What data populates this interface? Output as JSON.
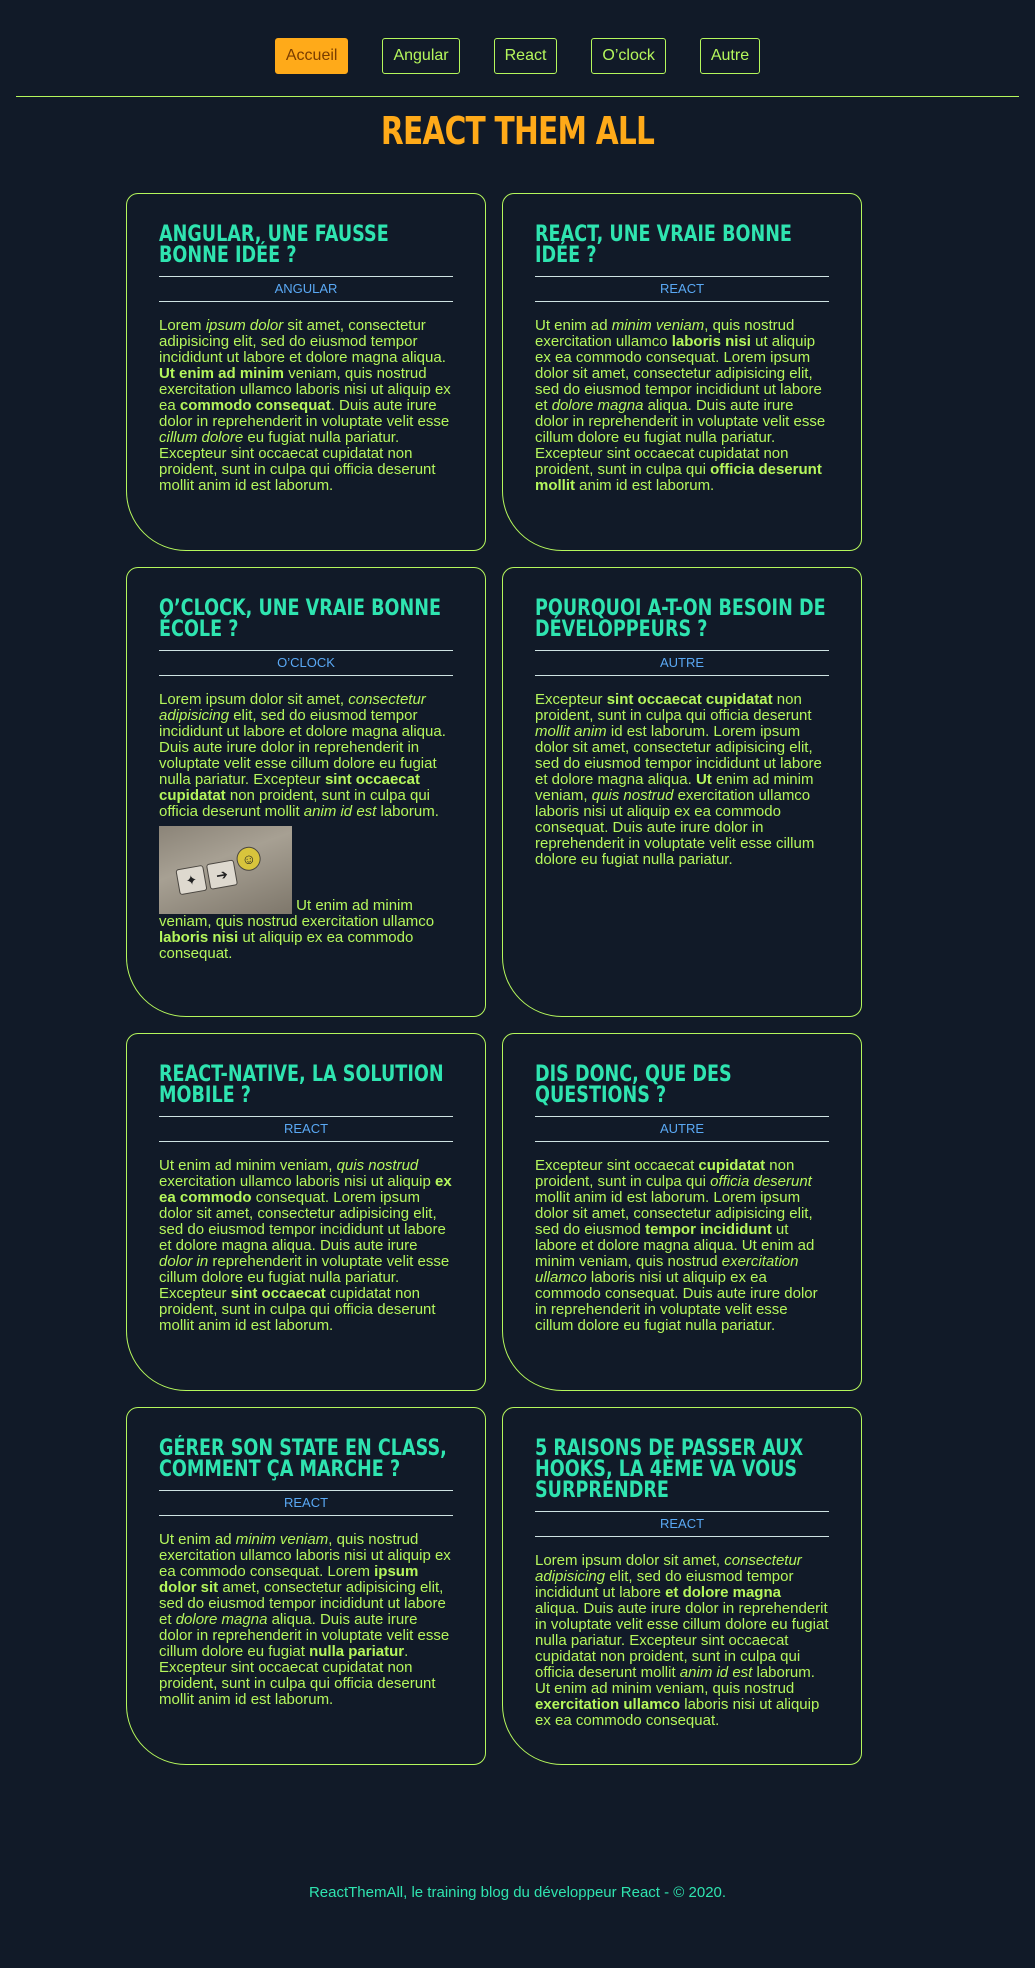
{
  "nav": {
    "items": [
      {
        "label": "Accueil",
        "active": true
      },
      {
        "label": "Angular",
        "active": false
      },
      {
        "label": "React",
        "active": false
      },
      {
        "label": "O’clock",
        "active": false
      },
      {
        "label": "Autre",
        "active": false
      }
    ]
  },
  "site_title": "REACT THEM ALL",
  "colors": {
    "background": "#111a28",
    "accent_orange": "#ffaa19",
    "text_green": "#b5f75c",
    "title_teal": "#2fe4b0",
    "category_blue": "#5aa9f5"
  },
  "cards": [
    {
      "title": "Angular, une fausse bonne idée ?",
      "category": "Angular",
      "body_html": "Lorem <i>ipsum dolor</i> sit amet, consectetur adipisicing elit, sed do eiusmod tempor incididunt ut labore et dolore magna aliqua. <b>Ut enim ad minim</b> veniam, quis nostrud exercitation ullamco laboris nisi ut aliquip ex ea <b>commodo consequat</b>. Duis aute irure dolor in reprehenderit in voluptate velit esse <i>cillum dolore</i> eu fugiat nulla pariatur. Excepteur sint occaecat cupidatat non proident, sunt in culpa qui officia deserunt mollit anim id est laborum."
    },
    {
      "title": "React, une vraie bonne idée ?",
      "category": "React",
      "body_html": "Ut enim ad <i>minim veniam</i>, quis nostrud exercitation ullamco <b>laboris nisi</b> ut aliquip ex ea commodo consequat. Lorem ipsum dolor sit amet, consectetur adipisicing elit, sed do eiusmod tempor incididunt ut labore et <i>dolore magna</i> aliqua. Duis aute irure dolor in reprehenderit in voluptate velit esse cillum dolore eu fugiat nulla pariatur. Excepteur sint occaecat cupidatat non proident, sunt in culpa qui <b>officia deserunt mollit</b> anim id est laborum."
    },
    {
      "title": "O’clock, une vraie bonne école ?",
      "category": "O’clock",
      "body_html": "Lorem ipsum dolor sit amet, <i>consectetur adipisicing</i> elit, sed do eiusmod tempor incididunt ut labore et dolore magna aliqua. Duis aute irure dolor in reprehenderit in voluptate velit esse cillum dolore eu fugiat nulla pariatur. Excepteur <b>sint occaecat cupidatat</b> non proident, sunt in culpa qui officia deserunt mollit <i>anim id est</i> laborum.",
      "image_alt": "keyboard keys with arrow and smiley",
      "after_image_html": " Ut enim ad minim veniam, quis nostrud exercitation ullamco <b>laboris nisi</b> ut aliquip ex ea commodo consequat."
    },
    {
      "title": "Pourquoi a-t-on besoin de développeurs ?",
      "category": "Autre",
      "body_html": "Excepteur <b>sint occaecat cupidatat</b> non proident, sunt in culpa qui officia deserunt <i>mollit anim</i> id est laborum. Lorem ipsum dolor sit amet, consectetur adipisicing elit, sed do eiusmod tempor incididunt ut labore et dolore magna aliqua. <b>Ut</b> enim ad minim veniam, <i>quis nostrud</i> exercitation ullamco laboris nisi ut aliquip ex ea commodo consequat. Duis aute irure dolor in reprehenderit in voluptate velit esse cillum dolore eu fugiat nulla pariatur."
    },
    {
      "title": "React-native, la solution mobile ?",
      "category": "React",
      "body_html": "Ut enim ad minim veniam, <i>quis nostrud</i> exercitation ullamco laboris nisi ut aliquip <b>ex ea commodo</b> consequat. Lorem ipsum dolor sit amet, consectetur adipisicing elit, sed do eiusmod tempor incididunt ut labore et dolore magna aliqua. Duis aute irure <i>dolor in</i> reprehenderit in voluptate velit esse cillum dolore eu fugiat nulla pariatur. Excepteur <b>sint occaecat</b> cupidatat non proident, sunt in culpa qui officia deserunt mollit anim id est laborum."
    },
    {
      "title": "Dis donc, que des questions ?",
      "category": "Autre",
      "body_html": "Excepteur sint occaecat <b>cupidatat</b> non proident, sunt in culpa qui <i>officia deserunt</i> mollit anim id est laborum. Lorem ipsum dolor sit amet, consectetur adipisicing elit, sed do eiusmod <b>tempor incididunt</b> ut labore et dolore magna aliqua. Ut enim ad minim veniam, quis nostrud <i>exercitation ullamco</i> laboris nisi ut aliquip ex ea commodo consequat. Duis aute irure dolor in reprehenderit in voluptate velit esse cillum dolore eu fugiat nulla pariatur."
    },
    {
      "title": "Gérer son state en class, comment ça marche ?",
      "category": "React",
      "body_html": "Ut enim ad <i>minim veniam</i>, quis nostrud exercitation ullamco laboris nisi ut aliquip ex ea commodo consequat. Lorem <b>ipsum dolor sit</b> amet, consectetur adipisicing elit, sed do eiusmod tempor incididunt ut labore et <i>dolore magna</i> aliqua. Duis aute irure dolor in reprehenderit in voluptate velit esse cillum dolore eu fugiat <b>nulla pariatur</b>. Excepteur sint occaecat cupidatat non proident, sunt in culpa qui officia deserunt mollit anim id est laborum."
    },
    {
      "title": "5 raisons de passer aux hooks, la 4ème va vous surprendre",
      "category": "React",
      "body_html": "Lorem ipsum dolor sit amet, <i>consectetur adipisicing</i> elit, sed do eiusmod tempor incididunt ut labore <b>et dolore magna</b> aliqua. Duis aute irure dolor in reprehenderit in voluptate velit esse cillum dolore eu fugiat nulla pariatur. Excepteur sint occaecat cupidatat non proident, sunt in culpa qui officia deserunt mollit <i>anim id est</i> laborum. Ut enim ad minim veniam, quis nostrud <b>exercitation ullamco</b> laboris nisi ut aliquip ex ea commodo consequat."
    }
  ],
  "footer": "ReactThemAll, le training blog du développeur React - © 2020."
}
